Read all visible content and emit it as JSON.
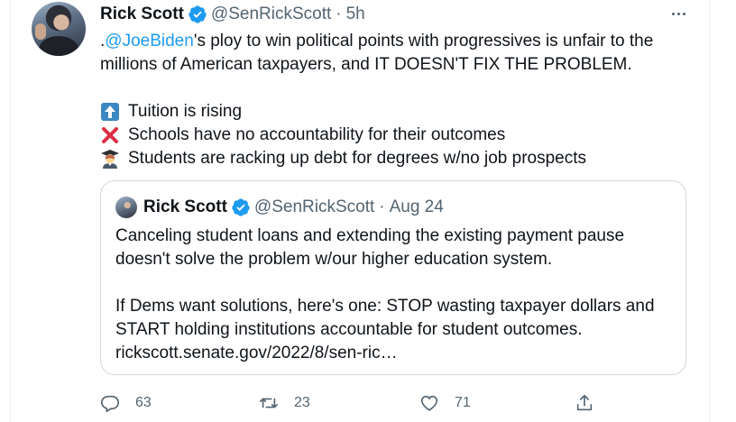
{
  "tweet": {
    "author": {
      "name": "Rick Scott",
      "handle": "@SenRickScott",
      "separator": "·",
      "time": "5h",
      "verified_color": "#1d9bf0"
    },
    "text": {
      "line1_prefix": ".",
      "mention": "@JoeBiden",
      "line1_rest": "'s ploy to win political points with progressives is unfair to the",
      "line2": "millions of American taxpayers, and IT DOESN'T FIX THE PROBLEM.",
      "list": [
        {
          "icon": "up-arrow-emoji",
          "text": "Tuition is rising"
        },
        {
          "icon": "red-x-emoji",
          "text": "Schools have no accountability for their outcomes"
        },
        {
          "icon": "graduate-emoji",
          "text": "Students are racking up debt for degrees w/no job prospects"
        }
      ]
    },
    "quote": {
      "name": "Rick Scott",
      "handle": "@SenRickScott",
      "separator": "·",
      "time": "Aug 24",
      "lines": [
        "Canceling student loans and extending the existing payment pause",
        "doesn't solve the problem w/our higher education system.",
        "",
        "If Dems want solutions, here's one: STOP wasting taxpayer dollars and",
        "START holding institutions accountable for student outcomes.",
        "rickscott.senate.gov/2022/8/sen-ric…"
      ]
    },
    "actions": {
      "replies": "63",
      "retweets": "23",
      "likes": "71"
    },
    "colors": {
      "accent": "#1d9bf0",
      "muted": "#536471",
      "text": "#0f1419"
    }
  }
}
